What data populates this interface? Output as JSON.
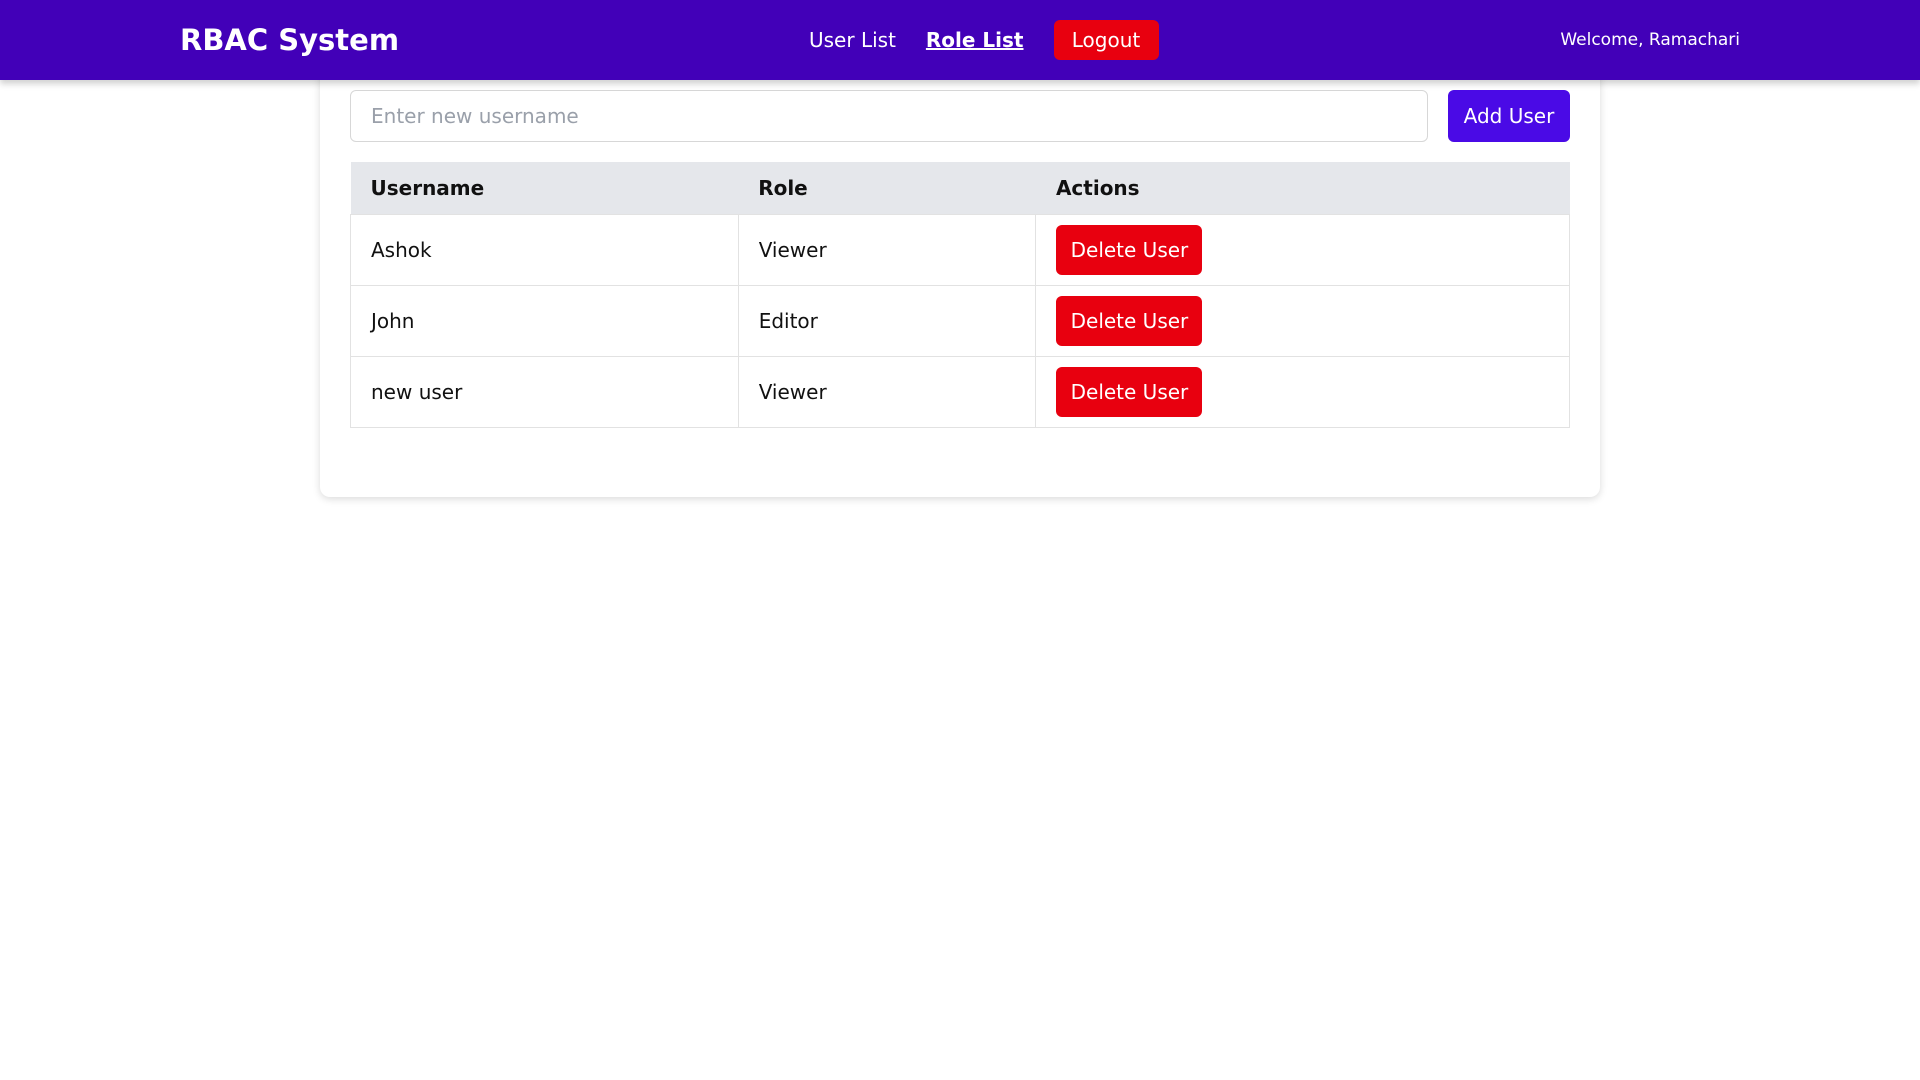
{
  "header": {
    "brand": "RBAC System",
    "nav": {
      "user_list": "User List",
      "role_list": "Role List"
    },
    "logout_label": "Logout",
    "welcome": "Welcome, Ramachari"
  },
  "add_user": {
    "placeholder": "Enter new username",
    "value": "",
    "button_label": "Add User"
  },
  "table": {
    "columns": [
      "Username",
      "Role",
      "Actions"
    ],
    "rows": [
      {
        "username": "Ashok",
        "role": "Viewer",
        "action_label": "Delete User"
      },
      {
        "username": "John",
        "role": "Editor",
        "action_label": "Delete User"
      },
      {
        "username": "new user",
        "role": "Viewer",
        "action_label": "Delete User"
      }
    ]
  },
  "colors": {
    "header_bg": "#4200b8",
    "primary_button": "#4a0ae6",
    "danger_button": "#e8000f",
    "table_header_bg": "#e5e7eb"
  }
}
